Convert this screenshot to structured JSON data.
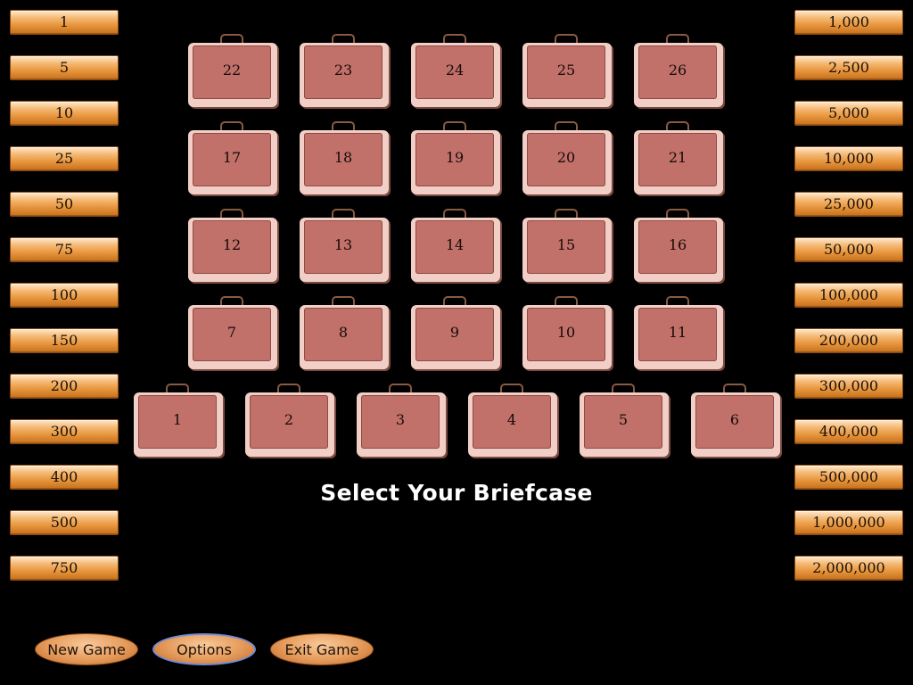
{
  "left_values": [
    "1",
    "5",
    "10",
    "25",
    "50",
    "75",
    "100",
    "150",
    "200",
    "300",
    "400",
    "500",
    "750"
  ],
  "right_values": [
    "1,000",
    "2,500",
    "5,000",
    "10,000",
    "25,000",
    "50,000",
    "100,000",
    "200,000",
    "300,000",
    "400,000",
    "500,000",
    "1,000,000",
    "2,000,000"
  ],
  "case_rows": [
    [
      "22",
      "23",
      "24",
      "25",
      "26"
    ],
    [
      "17",
      "18",
      "19",
      "20",
      "21"
    ],
    [
      "12",
      "13",
      "14",
      "15",
      "16"
    ],
    [
      "7",
      "8",
      "9",
      "10",
      "11"
    ],
    [
      "1",
      "2",
      "3",
      "4",
      "5",
      "6"
    ]
  ],
  "prompt": "Select Your Briefcase",
  "menu": {
    "new_game": "New Game",
    "options": "Options",
    "exit_game": "Exit Game"
  },
  "colors": {
    "background": "#000000",
    "case_face": "#c1716a",
    "case_rim": "#f1cfc6",
    "money_tag": "#e8963e"
  }
}
